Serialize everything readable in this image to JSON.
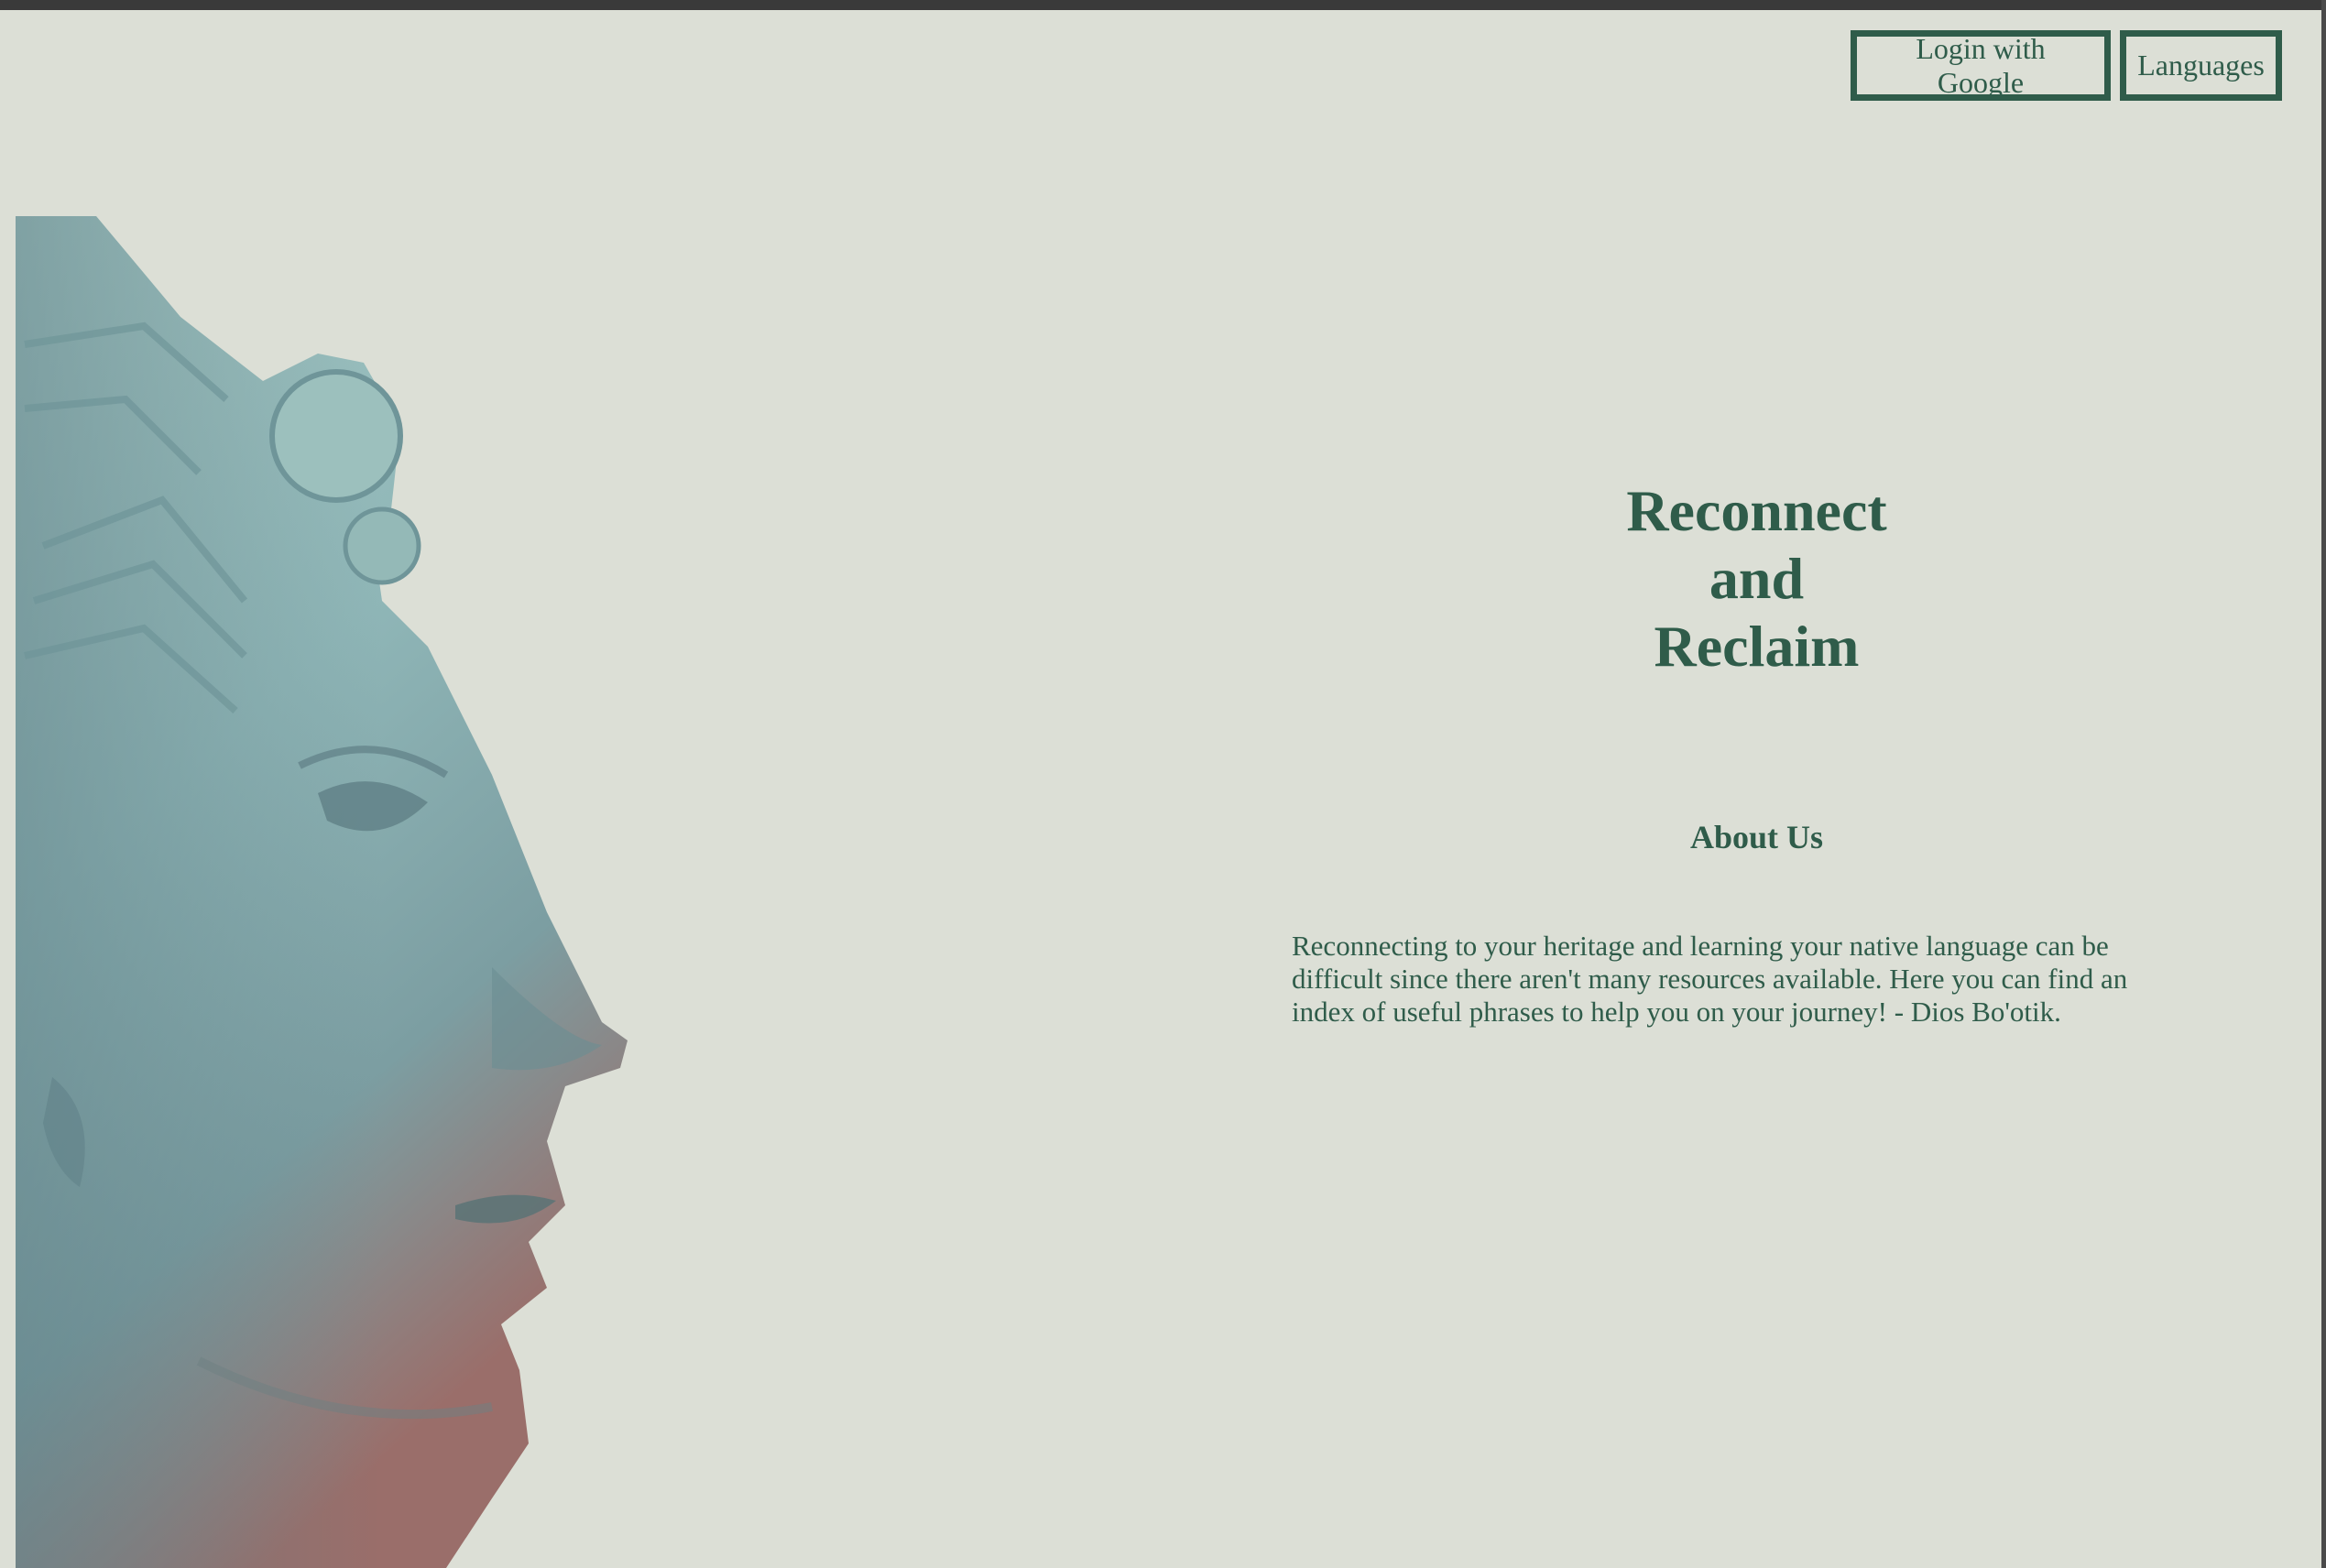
{
  "nav": {
    "login_label": "Login with Google",
    "languages_label": "Languages"
  },
  "hero": {
    "headline_lines": [
      "Reconnect",
      "and",
      "Reclaim"
    ]
  },
  "about": {
    "title": "About Us",
    "text": "Reconnecting to your heritage and learning your native language can be difficult since there aren't many resources available. Here you can find an index of useful phrases to help you on your journey! - Dios Bo'otik."
  },
  "colors": {
    "background": "#dcdfd6",
    "accent": "#2f5c4a"
  },
  "image": {
    "icon": "stone-head-sculpture-icon"
  }
}
